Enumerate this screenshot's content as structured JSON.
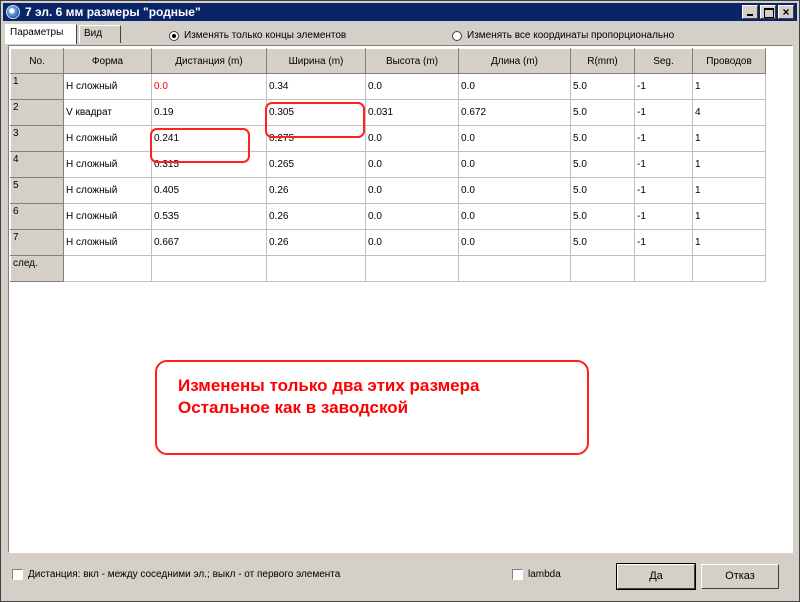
{
  "window": {
    "title": "7 эл. 6 мм размеры \"родные\""
  },
  "tabs": [
    "Параметры",
    "Вид"
  ],
  "radios": [
    {
      "label": "Изменять только концы элементов",
      "checked": true
    },
    {
      "label": "Изменять все координаты пропорционально",
      "checked": false
    }
  ],
  "table": {
    "columns": [
      "No.",
      "Форма",
      "Дистанция (m)",
      "Ширина (m)",
      "Высота (m)",
      "Длина (m)",
      "R(mm)",
      "Seg.",
      "Проводов"
    ],
    "rows": [
      [
        "1",
        "H сложный",
        "0.0",
        "0.34",
        "0.0",
        "0.0",
        "5.0",
        "-1",
        "1"
      ],
      [
        "2",
        "V квадрат",
        "0.19",
        "0.305",
        "0.031",
        "0.672",
        "5.0",
        "-1",
        "4"
      ],
      [
        "3",
        "H сложный",
        "0.241",
        "0.275",
        "0.0",
        "0.0",
        "5.0",
        "-1",
        "1"
      ],
      [
        "4",
        "H сложный",
        "0.315",
        "0.265",
        "0.0",
        "0.0",
        "5.0",
        "-1",
        "1"
      ],
      [
        "5",
        "H сложный",
        "0.405",
        "0.26",
        "0.0",
        "0.0",
        "5.0",
        "-1",
        "1"
      ],
      [
        "6",
        "H сложный",
        "0.535",
        "0.26",
        "0.0",
        "0.0",
        "5.0",
        "-1",
        "1"
      ],
      [
        "7",
        "H сложный",
        "0.667",
        "0.26",
        "0.0",
        "0.0",
        "5.0",
        "-1",
        "1"
      ],
      [
        "след.",
        "",
        "",
        "",
        "",
        "",
        "",
        "",
        ""
      ]
    ]
  },
  "annotation": {
    "line1": "Изменены только два этих размера",
    "line2": "Остальное как в заводской"
  },
  "footer": {
    "distance_checkbox": {
      "label": "Дистанция: вкл - между соседними эл.; выкл - от первого элемента",
      "checked": false
    },
    "lambda_checkbox": {
      "label": "lambda",
      "checked": false
    },
    "ok_label": "Да",
    "cancel_label": "Отказ"
  },
  "colors": {
    "titlebar": "#0a246a",
    "annotation": "#ff0000",
    "highlight_value": "#ff0000"
  },
  "icons": [
    "app-globe-icon",
    "minimize-icon",
    "maximize-icon",
    "close-icon"
  ]
}
